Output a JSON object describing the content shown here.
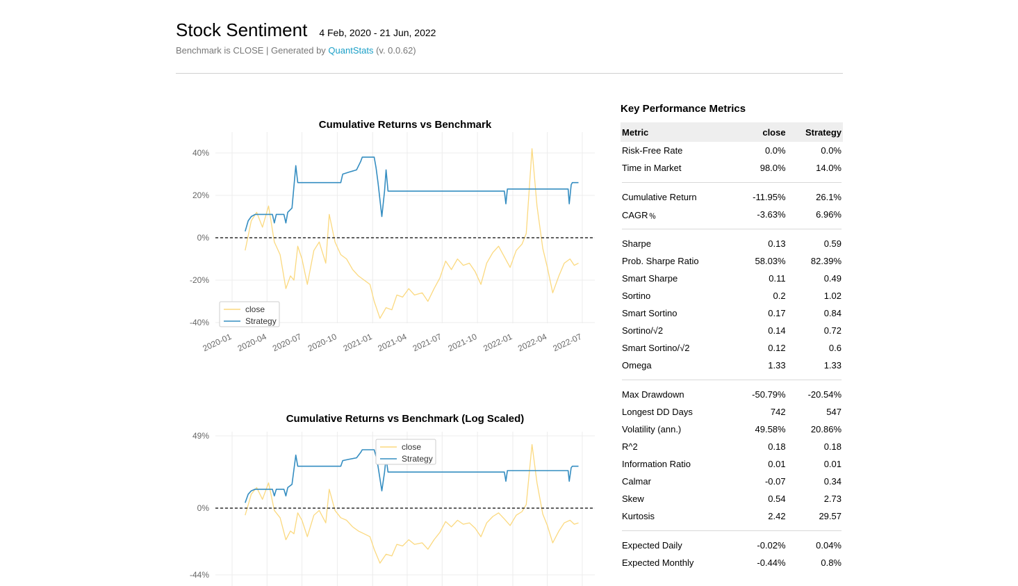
{
  "header": {
    "title": "Stock Sentiment",
    "date_range": "4 Feb, 2020 - 21 Jun, 2022",
    "subtitle_prefix": "Benchmark is CLOSE | Generated by ",
    "link_text": "QuantStats",
    "version": " (v. 0.0.62)"
  },
  "colors": {
    "close": "#fbd97f",
    "strategy": "#348dc1",
    "link": "#1a9fc7"
  },
  "chart_data": [
    {
      "type": "line",
      "title": "Cumulative Returns vs Benchmark",
      "x_ticks": [
        "2020-01",
        "2020-04",
        "2020-07",
        "2020-10",
        "2021-01",
        "2021-04",
        "2021-07",
        "2021-10",
        "2022-01",
        "2022-04",
        "2022-07"
      ],
      "y_ticks": [
        "40%",
        "20%",
        "0%",
        "-20%",
        "-40%"
      ],
      "ylim": [
        -42,
        45
      ],
      "reference_line": 0,
      "legend": "bottom-left",
      "grid": true,
      "series": [
        {
          "name": "close",
          "points": [
            [
              "2020-02-04",
              -6
            ],
            [
              "2020-02-20",
              8
            ],
            [
              "2020-03-05",
              12
            ],
            [
              "2020-03-20",
              5
            ],
            [
              "2020-04-05",
              15
            ],
            [
              "2020-04-20",
              -2
            ],
            [
              "2020-05-05",
              -8
            ],
            [
              "2020-05-20",
              -24
            ],
            [
              "2020-06-01",
              -18
            ],
            [
              "2020-06-10",
              -20
            ],
            [
              "2020-06-20",
              -4
            ],
            [
              "2020-07-01",
              -10
            ],
            [
              "2020-07-15",
              -22
            ],
            [
              "2020-08-01",
              -6
            ],
            [
              "2020-08-15",
              -2
            ],
            [
              "2020-09-01",
              -12
            ],
            [
              "2020-09-10",
              11
            ],
            [
              "2020-09-25",
              -2
            ],
            [
              "2020-10-10",
              -8
            ],
            [
              "2020-10-25",
              -10
            ],
            [
              "2020-11-10",
              -15
            ],
            [
              "2020-11-25",
              -18
            ],
            [
              "2020-12-10",
              -20
            ],
            [
              "2020-12-25",
              -22
            ],
            [
              "2021-01-05",
              -30
            ],
            [
              "2021-01-20",
              -38
            ],
            [
              "2021-02-05",
              -33
            ],
            [
              "2021-02-20",
              -34
            ],
            [
              "2021-03-05",
              -27
            ],
            [
              "2021-03-20",
              -28
            ],
            [
              "2021-04-05",
              -24
            ],
            [
              "2021-04-20",
              -27
            ],
            [
              "2021-05-10",
              -26
            ],
            [
              "2021-05-25",
              -30
            ],
            [
              "2021-06-10",
              -24
            ],
            [
              "2021-06-25",
              -19
            ],
            [
              "2021-07-10",
              -11
            ],
            [
              "2021-07-25",
              -15
            ],
            [
              "2021-08-10",
              -10
            ],
            [
              "2021-08-25",
              -13
            ],
            [
              "2021-09-10",
              -12
            ],
            [
              "2021-09-25",
              -16
            ],
            [
              "2021-10-10",
              -22
            ],
            [
              "2021-10-25",
              -12
            ],
            [
              "2021-11-10",
              -7
            ],
            [
              "2021-11-25",
              -4
            ],
            [
              "2021-12-10",
              -9
            ],
            [
              "2021-12-25",
              -14
            ],
            [
              "2022-01-10",
              -6
            ],
            [
              "2022-01-25",
              -3
            ],
            [
              "2022-02-05",
              2
            ],
            [
              "2022-02-20",
              42
            ],
            [
              "2022-03-05",
              15
            ],
            [
              "2022-03-20",
              -5
            ],
            [
              "2022-04-01",
              -14
            ],
            [
              "2022-04-15",
              -26
            ],
            [
              "2022-05-01",
              -18
            ],
            [
              "2022-05-15",
              -12
            ],
            [
              "2022-05-30",
              -10
            ],
            [
              "2022-06-10",
              -13
            ],
            [
              "2022-06-21",
              -12
            ]
          ]
        },
        {
          "name": "Strategy",
          "points": [
            [
              "2020-02-04",
              3
            ],
            [
              "2020-02-12",
              8
            ],
            [
              "2020-02-20",
              10
            ],
            [
              "2020-03-01",
              11
            ],
            [
              "2020-03-20",
              11
            ],
            [
              "2020-04-15",
              11
            ],
            [
              "2020-04-20",
              7
            ],
            [
              "2020-04-25",
              11
            ],
            [
              "2020-05-15",
              11
            ],
            [
              "2020-05-20",
              7
            ],
            [
              "2020-05-25",
              12
            ],
            [
              "2020-06-05",
              14
            ],
            [
              "2020-06-15",
              34
            ],
            [
              "2020-06-20",
              26
            ],
            [
              "2020-07-15",
              26
            ],
            [
              "2020-10-10",
              26
            ],
            [
              "2020-10-15",
              30
            ],
            [
              "2020-11-01",
              31
            ],
            [
              "2020-11-20",
              32
            ],
            [
              "2020-12-01",
              36
            ],
            [
              "2020-12-05",
              38
            ],
            [
              "2021-01-05",
              38
            ],
            [
              "2021-01-10",
              33
            ],
            [
              "2021-01-15",
              26
            ],
            [
              "2021-01-25",
              10
            ],
            [
              "2021-02-01",
              22
            ],
            [
              "2021-02-05",
              32
            ],
            [
              "2021-02-10",
              22
            ],
            [
              "2021-12-10",
              22
            ],
            [
              "2021-12-14",
              16
            ],
            [
              "2021-12-18",
              23
            ],
            [
              "2022-05-25",
              23
            ],
            [
              "2022-05-28",
              16
            ],
            [
              "2022-06-02",
              25
            ],
            [
              "2022-06-05",
              26
            ],
            [
              "2022-06-21",
              26
            ]
          ]
        }
      ]
    },
    {
      "type": "line",
      "title": "Cumulative Returns vs Benchmark (Log Scaled)",
      "y_ticks": [
        "49%",
        "0%",
        "-44%"
      ],
      "reference_line": 0,
      "legend": "top-center",
      "grid": true,
      "series": [
        {
          "name": "close"
        },
        {
          "name": "Strategy"
        }
      ]
    }
  ],
  "metrics": {
    "title": "Key Performance Metrics",
    "columns": [
      "Metric",
      "close",
      "Strategy"
    ],
    "groups": [
      [
        [
          "Risk-Free Rate",
          "0.0%",
          "0.0%"
        ],
        [
          "Time in Market",
          "98.0%",
          "14.0%"
        ]
      ],
      [
        [
          "Cumulative Return",
          "-11.95%",
          "26.1%"
        ],
        [
          "CAGR﹪",
          "-3.63%",
          "6.96%"
        ]
      ],
      [
        [
          "Sharpe",
          "0.13",
          "0.59"
        ],
        [
          "Prob. Sharpe Ratio",
          "58.03%",
          "82.39%"
        ],
        [
          "Smart Sharpe",
          "0.11",
          "0.49"
        ],
        [
          "Sortino",
          "0.2",
          "1.02"
        ],
        [
          "Smart Sortino",
          "0.17",
          "0.84"
        ],
        [
          "Sortino/√2",
          "0.14",
          "0.72"
        ],
        [
          "Smart Sortino/√2",
          "0.12",
          "0.6"
        ],
        [
          "Omega",
          "1.33",
          "1.33"
        ]
      ],
      [
        [
          "Max Drawdown",
          "-50.79%",
          "-20.54%"
        ],
        [
          "Longest DD Days",
          "742",
          "547"
        ],
        [
          "Volatility (ann.)",
          "49.58%",
          "20.86%"
        ],
        [
          "R^2",
          "0.18",
          "0.18"
        ],
        [
          "Information Ratio",
          "0.01",
          "0.01"
        ],
        [
          "Calmar",
          "-0.07",
          "0.34"
        ],
        [
          "Skew",
          "0.54",
          "2.73"
        ],
        [
          "Kurtosis",
          "2.42",
          "29.57"
        ]
      ],
      [
        [
          "Expected Daily",
          "-0.02%",
          "0.04%"
        ],
        [
          "Expected Monthly",
          "-0.44%",
          "0.8%"
        ]
      ]
    ]
  }
}
